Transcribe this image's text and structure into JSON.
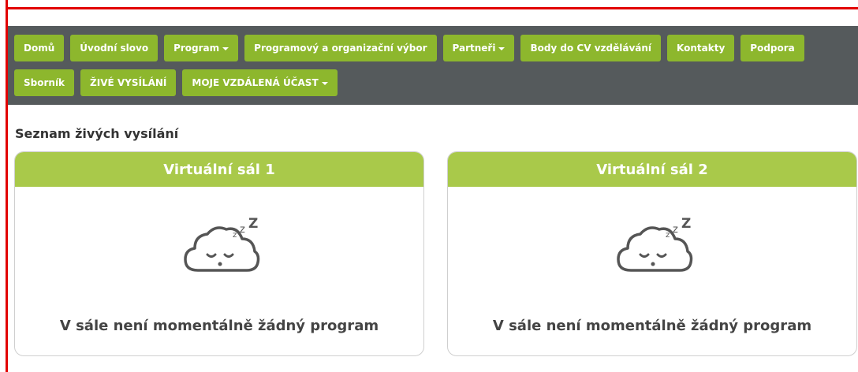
{
  "nav": {
    "row1": [
      {
        "label": "Domů",
        "dropdown": false
      },
      {
        "label": "Úvodní slovo",
        "dropdown": false
      },
      {
        "label": "Program",
        "dropdown": true
      },
      {
        "label": "Programový a organizační výbor",
        "dropdown": false
      },
      {
        "label": "Partneři",
        "dropdown": true
      },
      {
        "label": "Body do CV vzdělávání",
        "dropdown": false
      },
      {
        "label": "Kontakty",
        "dropdown": false
      },
      {
        "label": "Podpora",
        "dropdown": false
      }
    ],
    "row2": [
      {
        "label": "Sborník",
        "dropdown": false
      },
      {
        "label": "ŽIVÉ VYSÍLÁNÍ",
        "dropdown": false
      },
      {
        "label": "MOJE VZDÁLENÁ ÚČAST",
        "dropdown": true
      }
    ]
  },
  "page": {
    "title": "Seznam živých vysílání"
  },
  "halls": [
    {
      "name": "Virtuální sál 1",
      "message": "V sále není momentálně žádný program",
      "icon": "sleeping-cloud-icon"
    },
    {
      "name": "Virtuální sál 2",
      "message": "V sále není momentálně žádný program",
      "icon": "sleeping-cloud-icon"
    }
  ],
  "colors": {
    "nav_bg": "#555a5c",
    "button": "#8db72d",
    "card_header": "#a9c94a"
  }
}
